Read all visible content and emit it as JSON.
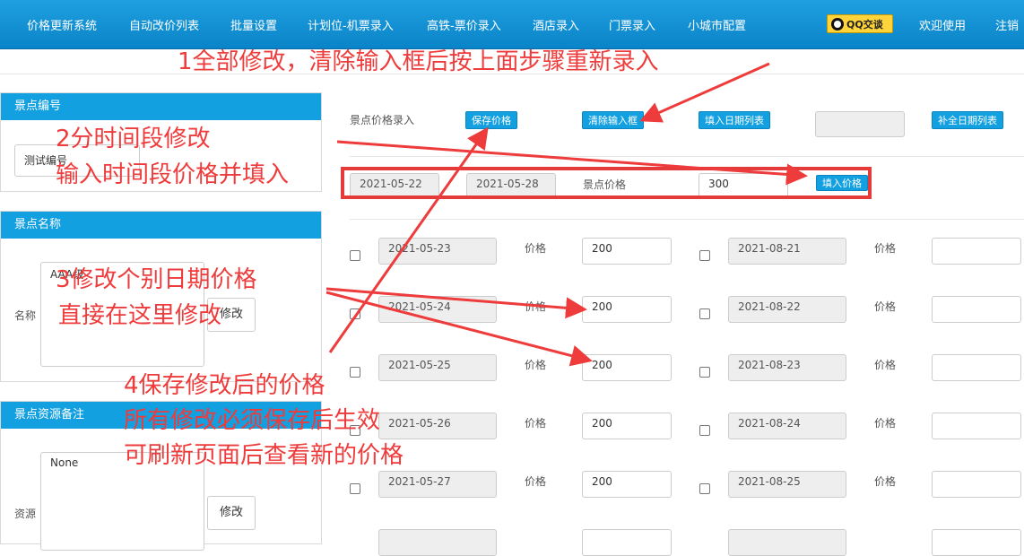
{
  "nav": {
    "items": [
      "价格更新系统",
      "自动改价列表",
      "批量设置",
      "计划位-机票录入",
      "高铁-票价录入",
      "酒店录入",
      "门票录入",
      "小城市配置"
    ],
    "qq_label": "QQ交谈",
    "welcome": "欢迎使用",
    "logout": "注销"
  },
  "left": {
    "code_panel": {
      "title": "景点编号",
      "value": "测试编号"
    },
    "name_panel": {
      "title": "景点名称",
      "label": "名称",
      "value": "AAA级",
      "button": "修改"
    },
    "note_panel": {
      "title": "景点资源备注",
      "label": "资源",
      "value": "None",
      "button": "修改"
    }
  },
  "toolbar": {
    "label": "景点价格录入",
    "save": "保存价格",
    "clear": "清除输入框",
    "fill_dates": "填入日期列表",
    "complete_dates": "补全日期列表"
  },
  "range": {
    "start": "2021-05-22",
    "end": "2021-05-28",
    "price_label": "景点价格",
    "price": "300",
    "fill_btn": "填入价格"
  },
  "price_label": "价格",
  "rows": [
    {
      "left_date": "2021-05-23",
      "left_price": "200",
      "right_date": "2021-08-21",
      "right_price": ""
    },
    {
      "left_date": "2021-05-24",
      "left_price": "200",
      "right_date": "2021-08-22",
      "right_price": ""
    },
    {
      "left_date": "2021-05-25",
      "left_price": "200",
      "right_date": "2021-08-23",
      "right_price": ""
    },
    {
      "left_date": "2021-05-26",
      "left_price": "200",
      "right_date": "2021-08-24",
      "right_price": ""
    },
    {
      "left_date": "2021-05-27",
      "left_price": "200",
      "right_date": "2021-08-25",
      "right_price": ""
    }
  ],
  "annotations": {
    "a1": "1全部修改，清除输入框后按上面步骤重新录入",
    "a2_line1": "2分时间段修改",
    "a2_line2": "输入时间段价格并填入",
    "a3_line1": "3修改个别日期价格",
    "a3_line2": "直接在这里修改",
    "a4_line1": "4保存修改后的价格",
    "a4_line2": "所有修改必须保存后生效",
    "a4_line3": "可刷新页面后查看新的价格"
  },
  "colors": {
    "nav_blue": "#0a84c8",
    "panel_blue": "#13a0e0",
    "annotation_red": "#ee3b3b"
  }
}
